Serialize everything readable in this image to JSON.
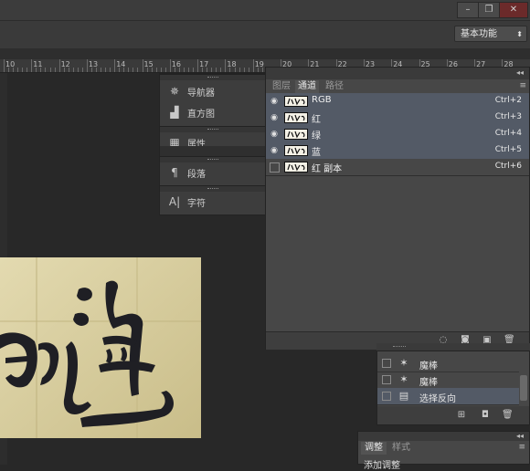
{
  "window": {
    "minimize_glyph": "–",
    "restore_glyph": "❐",
    "close_glyph": "✕"
  },
  "options_bar": {
    "workspace_label": "基本功能",
    "workspace_arrow": "⬍"
  },
  "ruler": {
    "labels": [
      "10",
      "11",
      "12",
      "13",
      "14",
      "15",
      "16",
      "17",
      "18",
      "19",
      "20",
      "21",
      "22",
      "23",
      "24",
      "25",
      "26",
      "27",
      "28"
    ]
  },
  "icon_panel": {
    "items": [
      {
        "label": "导航器",
        "icon": "navigator-icon"
      },
      {
        "label": "直方图",
        "icon": "histogram-icon"
      },
      {
        "label": "属性",
        "icon": "properties-icon"
      },
      {
        "label": "段落",
        "icon": "paragraph-icon"
      },
      {
        "label": "字符",
        "icon": "character-icon"
      }
    ]
  },
  "channels_panel": {
    "tabs": [
      "图层",
      "通道",
      "路径"
    ],
    "active_tab": "通道",
    "rows": [
      {
        "name": "RGB",
        "shortcut": "Ctrl+2",
        "visible": true
      },
      {
        "name": "红",
        "shortcut": "Ctrl+3",
        "visible": true
      },
      {
        "name": "绿",
        "shortcut": "Ctrl+4",
        "visible": true
      },
      {
        "name": "蓝",
        "shortcut": "Ctrl+5",
        "visible": true
      },
      {
        "name": "红 副本",
        "shortcut": "Ctrl+6",
        "visible": false
      }
    ],
    "footer_icons": [
      "load-selection-icon",
      "save-selection-icon",
      "new-channel-icon",
      "delete-icon"
    ]
  },
  "history_panel": {
    "rows": [
      {
        "label": "魔棒",
        "icon": "magic-wand-icon",
        "selected": false
      },
      {
        "label": "魔棒",
        "icon": "magic-wand-icon",
        "selected": false
      },
      {
        "label": "选择反向",
        "icon": "history-state-icon",
        "selected": true
      }
    ],
    "footer_icons": [
      "new-document-from-state-icon",
      "snapshot-icon",
      "delete-icon"
    ]
  },
  "adjustments_panel": {
    "tabs": [
      "调整",
      "样式"
    ],
    "active_tab": "调整",
    "heading": "添加调整"
  },
  "colors": {
    "accent_row": "#535a66",
    "panel_bg": "#474747",
    "paper": "#d9cfa1"
  }
}
